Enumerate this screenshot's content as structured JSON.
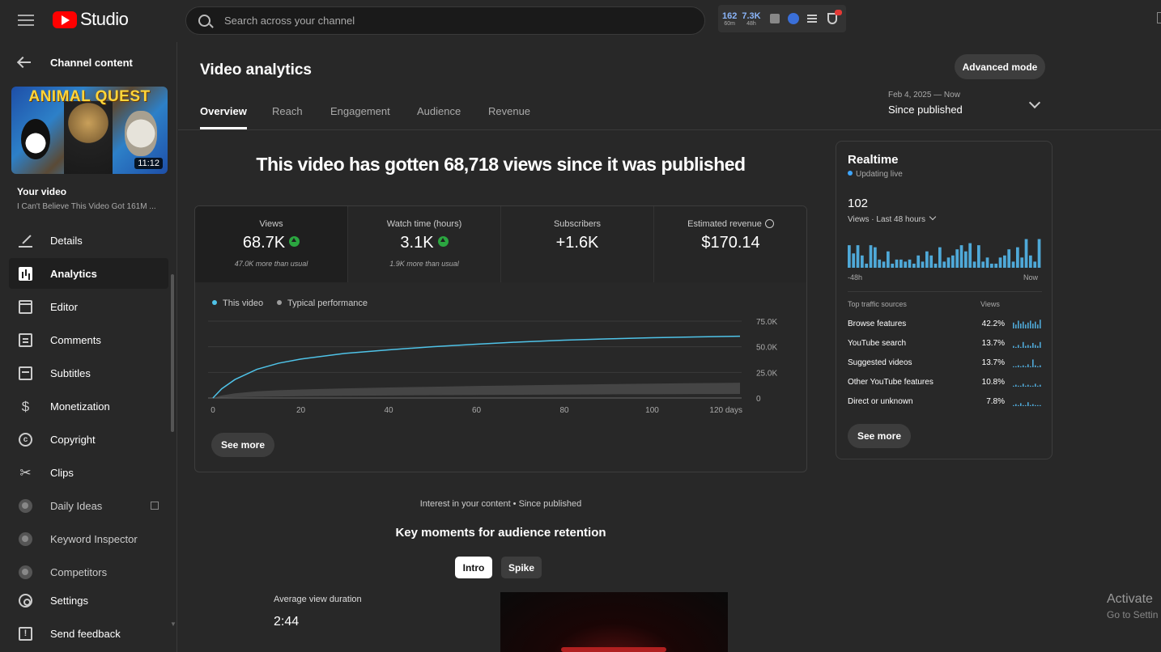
{
  "header": {
    "logo_text": "Studio",
    "search_placeholder": "Search across your channel",
    "ext_stats": [
      {
        "value": "162",
        "period": "60m"
      },
      {
        "value": "7.3K",
        "period": "48h"
      }
    ]
  },
  "sidebar": {
    "back_label": "Channel content",
    "thumbnail_title": "ANIMAL QUEST",
    "thumbnail_duration": "11:12",
    "your_video_label": "Your video",
    "video_title": "I Can't Believe This Video Got 161M ...",
    "items": [
      {
        "label": "Details",
        "icon": "pencil-icon"
      },
      {
        "label": "Analytics",
        "icon": "analytics-icon"
      },
      {
        "label": "Editor",
        "icon": "editor-icon"
      },
      {
        "label": "Comments",
        "icon": "comments-icon"
      },
      {
        "label": "Subtitles",
        "icon": "subtitles-icon"
      },
      {
        "label": "Monetization",
        "icon": "dollar-icon"
      },
      {
        "label": "Copyright",
        "icon": "copyright-icon"
      },
      {
        "label": "Clips",
        "icon": "scissors-icon"
      },
      {
        "label": "Daily Ideas",
        "icon": "extension-icon"
      },
      {
        "label": "Keyword Inspector",
        "icon": "extension-icon"
      },
      {
        "label": "Competitors",
        "icon": "extension-icon"
      },
      {
        "label": "Settings",
        "icon": "gear-icon"
      },
      {
        "label": "Send feedback",
        "icon": "feedback-icon"
      }
    ]
  },
  "main": {
    "title": "Video analytics",
    "advanced_label": "Advanced mode",
    "tabs": [
      "Overview",
      "Reach",
      "Engagement",
      "Audience",
      "Revenue"
    ],
    "date_range": "Feb 4, 2025 — Now",
    "date_label": "Since published",
    "headline": "This video has gotten 68,718 views since it was published",
    "metrics": [
      {
        "label": "Views",
        "value": "68.7K",
        "sub": "47.0K more than usual"
      },
      {
        "label": "Watch time (hours)",
        "value": "3.1K",
        "sub": "1.9K more than usual"
      },
      {
        "label": "Subscribers",
        "value": "+1.6K",
        "sub": ""
      },
      {
        "label": "Estimated revenue",
        "value": "$170.14",
        "sub": ""
      }
    ],
    "see_more": "See more",
    "interest_label": "Interest in your content • Since published",
    "key_moments_title": "Key moments for audience retention",
    "moment_buttons": [
      "Intro",
      "Spike"
    ],
    "avg_duration_label": "Average view duration",
    "avg_duration_value": "2:44"
  },
  "chart_data": {
    "type": "line",
    "series": [
      {
        "name": "This video",
        "color": "#4fc3e8",
        "x": [
          0,
          2,
          5,
          10,
          15,
          20,
          30,
          40,
          50,
          60,
          70,
          80,
          90,
          100,
          110,
          120
        ],
        "values": [
          0,
          9000,
          18000,
          28000,
          34000,
          38000,
          43500,
          47000,
          50000,
          52500,
          54700,
          56400,
          57700,
          58800,
          59600,
          60300
        ]
      },
      {
        "name": "Typical performance",
        "color": "#9e9e9e",
        "band_low": [
          0,
          400,
          800,
          1200,
          1500,
          1800,
          2200,
          2500,
          2800,
          3000,
          3200,
          3400,
          3600,
          3700,
          3800,
          3900
        ],
        "band_high": [
          0,
          2500,
          4500,
          6500,
          7600,
          8300,
          9400,
          10300,
          11000,
          11700,
          12300,
          12900,
          13500,
          14000,
          14500,
          14900
        ]
      }
    ],
    "x_ticks": [
      "0",
      "20",
      "40",
      "60",
      "80",
      "100",
      "120 days"
    ],
    "x_tick_values": [
      0,
      20,
      40,
      60,
      80,
      100,
      120
    ],
    "y_ticks": [
      "0",
      "25.0K",
      "50.0K",
      "75.0K"
    ],
    "y_tick_values": [
      0,
      25000,
      50000,
      75000
    ],
    "xlim": [
      0,
      120
    ],
    "ylim": [
      0,
      75000
    ],
    "legend_placement": "top-left",
    "grid": true
  },
  "realtime": {
    "title": "Realtime",
    "status": "Updating live",
    "count": "102",
    "period_label": "Views · Last 48 hours",
    "bars": [
      22,
      14,
      22,
      12,
      4,
      22,
      20,
      8,
      6,
      16,
      4,
      8,
      8,
      6,
      8,
      4,
      12,
      6,
      16,
      12,
      4,
      20,
      6,
      10,
      12,
      18,
      22,
      16,
      24,
      6,
      22,
      6,
      10,
      4,
      4,
      10,
      12,
      18,
      6,
      20,
      10,
      28,
      12,
      6,
      28
    ],
    "bar_color": "#4fa9d8",
    "x_start": "-48h",
    "x_end": "Now",
    "sources_header": "Top traffic sources",
    "views_header": "Views",
    "sources": [
      {
        "name": "Browse features",
        "pct": "42.2%",
        "spark": [
          6,
          4,
          8,
          5,
          7,
          4,
          6,
          8,
          5,
          7,
          4,
          9
        ]
      },
      {
        "name": "YouTube search",
        "pct": "13.7%",
        "spark": [
          2,
          1,
          3,
          1,
          6,
          2,
          3,
          2,
          5,
          3,
          2,
          6
        ]
      },
      {
        "name": "Suggested videos",
        "pct": "13.7%",
        "spark": [
          1,
          1,
          2,
          1,
          2,
          1,
          3,
          1,
          8,
          2,
          1,
          2
        ]
      },
      {
        "name": "Other YouTube features",
        "pct": "10.8%",
        "spark": [
          1,
          2,
          1,
          1,
          3,
          1,
          2,
          1,
          1,
          3,
          1,
          2
        ]
      },
      {
        "name": "Direct or unknown",
        "pct": "7.8%",
        "spark": [
          1,
          2,
          1,
          3,
          1,
          1,
          4,
          1,
          2,
          1,
          1,
          1
        ]
      }
    ],
    "see_more": "See more"
  },
  "watermark": {
    "line1": "Activate",
    "line2": "Go to Settin"
  }
}
